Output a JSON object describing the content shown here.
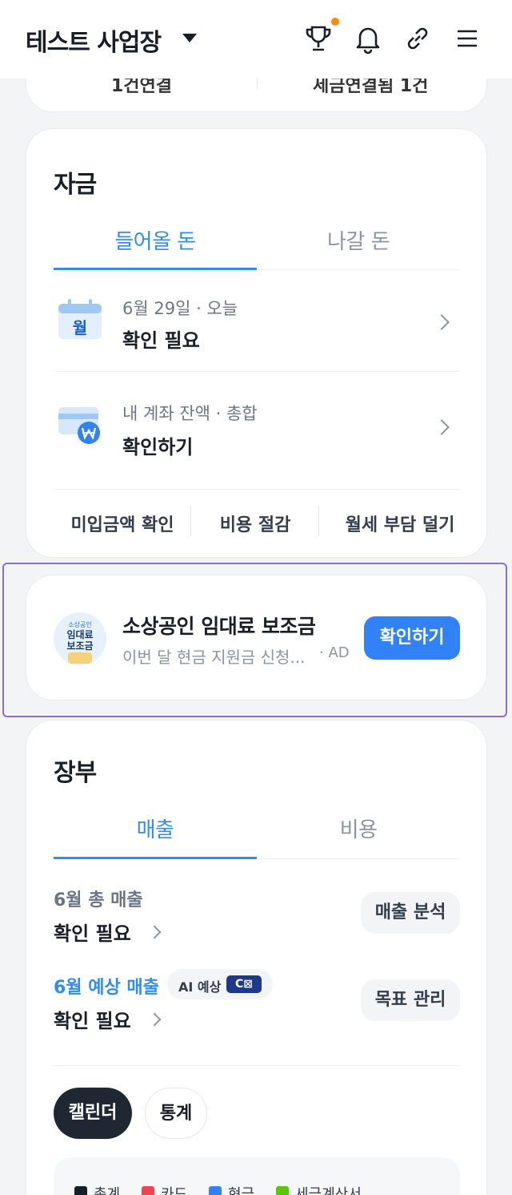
{
  "header": {
    "title": "테스트 사업장",
    "icons": [
      "trophy-icon",
      "bell-icon",
      "link-icon",
      "menu-icon"
    ],
    "notification_color": "#ff8a00"
  },
  "top_card": {
    "left_text": "1건연결",
    "right_text": "세금연결됨 1건"
  },
  "funds": {
    "title": "자금",
    "tabs": [
      "들어올 돈",
      "나갈 돈"
    ],
    "rows": [
      {
        "sub": "6월 29일 · 오늘",
        "main": "확인 필요",
        "icon_label": "월"
      },
      {
        "sub": "내 계좌 잔액 · 총합",
        "main": "확인하기"
      }
    ],
    "quick_links": [
      "미입금액 확인",
      "비용 절감",
      "월세 부담 덜기"
    ]
  },
  "ad": {
    "thumb_small": "소상공인",
    "thumb_large": "임대료\n보조금",
    "title": "소상공인 임대료 보조금",
    "desc": "이번 달 현금 지원금 신청...",
    "tag": "· AD",
    "button": "확인하기"
  },
  "ledger": {
    "title": "장부",
    "tabs": [
      "매출",
      "비용"
    ],
    "total_label": "6월 총 매출",
    "total_value": "확인 필요",
    "total_button": "매출 분석",
    "forecast_label": "6월 예상 매출",
    "ai_badge": "AI 예상",
    "ai_logo": "C⊠",
    "forecast_value": "확인 필요",
    "forecast_button": "목표 관리",
    "view_toggle": [
      "캘린더",
      "통계"
    ],
    "legend": [
      {
        "label": "총계",
        "color": "#191f28"
      },
      {
        "label": "카드",
        "color": "#f04452"
      },
      {
        "label": "현금",
        "color": "#3182f6"
      },
      {
        "label": "세금계산서",
        "color": "#5ac800"
      }
    ]
  },
  "colors": {
    "accent": "#2f8cf5",
    "button": "#3182f6",
    "ad_highlight": "#8b6cd9"
  }
}
